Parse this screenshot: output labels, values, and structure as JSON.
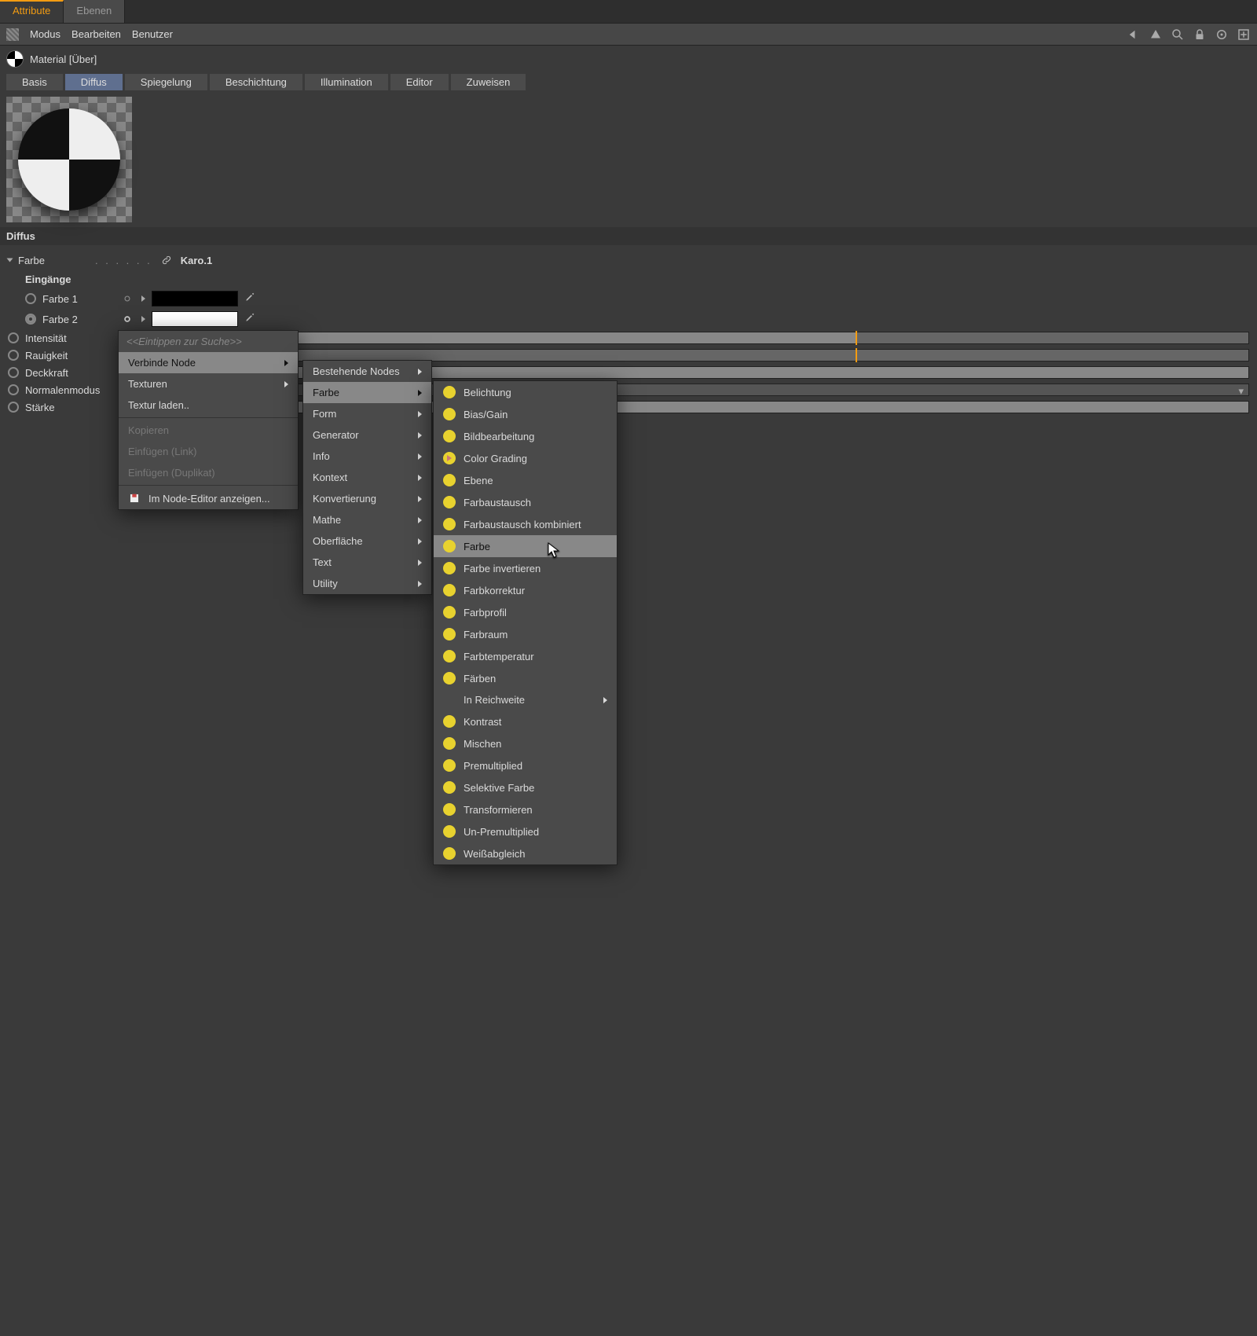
{
  "tabs": {
    "attribute": "Attribute",
    "ebenen": "Ebenen"
  },
  "toolbar": {
    "modus": "Modus",
    "bearbeiten": "Bearbeiten",
    "benutzer": "Benutzer"
  },
  "material_title": "Material [Über]",
  "shader_tabs": {
    "basis": "Basis",
    "diffus": "Diffus",
    "spiegelung": "Spiegelung",
    "beschichtung": "Beschichtung",
    "illumination": "Illumination",
    "editor": "Editor",
    "zuweisen": "Zuweisen"
  },
  "section_head": "Diffus",
  "params": {
    "farbe_label": "Farbe",
    "farbe_value": "Karo.1",
    "eingaenge": "Eingänge",
    "farbe1": "Farbe 1",
    "farbe2": "Farbe 2",
    "intensitaet": "Intensität",
    "rauigkeit": "Rauigkeit",
    "deckkraft": "Deckkraft",
    "normalenmodus": "Normalenmodus",
    "staerke": "Stärke"
  },
  "ctx1": {
    "search": "<<Eintippen zur Suche>>",
    "verbinde": "Verbinde Node",
    "texturen": "Texturen",
    "textur_laden": "Textur laden..",
    "kopieren": "Kopieren",
    "einfuegen_link": "Einfügen (Link)",
    "einfuegen_dup": "Einfügen (Duplikat)",
    "node_editor": "Im Node-Editor anzeigen..."
  },
  "ctx2": {
    "bestehende": "Bestehende Nodes",
    "farbe": "Farbe",
    "form": "Form",
    "generator": "Generator",
    "info": "Info",
    "kontext": "Kontext",
    "konvertierung": "Konvertierung",
    "mathe": "Mathe",
    "oberflaeche": "Oberfläche",
    "text": "Text",
    "utility": "Utility"
  },
  "ctx3": {
    "belichtung": "Belichtung",
    "biasgain": "Bias/Gain",
    "bildbearbeitung": "Bildbearbeitung",
    "colorgrading": "Color Grading",
    "ebene": "Ebene",
    "farbaustausch": "Farbaustausch",
    "farbaustausch_k": "Farbaustausch kombiniert",
    "farbe": "Farbe",
    "farbe_inv": "Farbe invertieren",
    "farbkorrektur": "Farbkorrektur",
    "farbprofil": "Farbprofil",
    "farbraum": "Farbraum",
    "farbtemperatur": "Farbtemperatur",
    "faerben": "Färben",
    "inreichweite": "In Reichweite",
    "kontrast": "Kontrast",
    "mischen": "Mischen",
    "premultiplied": "Premultiplied",
    "selektive": "Selektive Farbe",
    "transformieren": "Transformieren",
    "unpremultiplied": "Un-Premultiplied",
    "weissabgleich": "Weißabgleich"
  }
}
